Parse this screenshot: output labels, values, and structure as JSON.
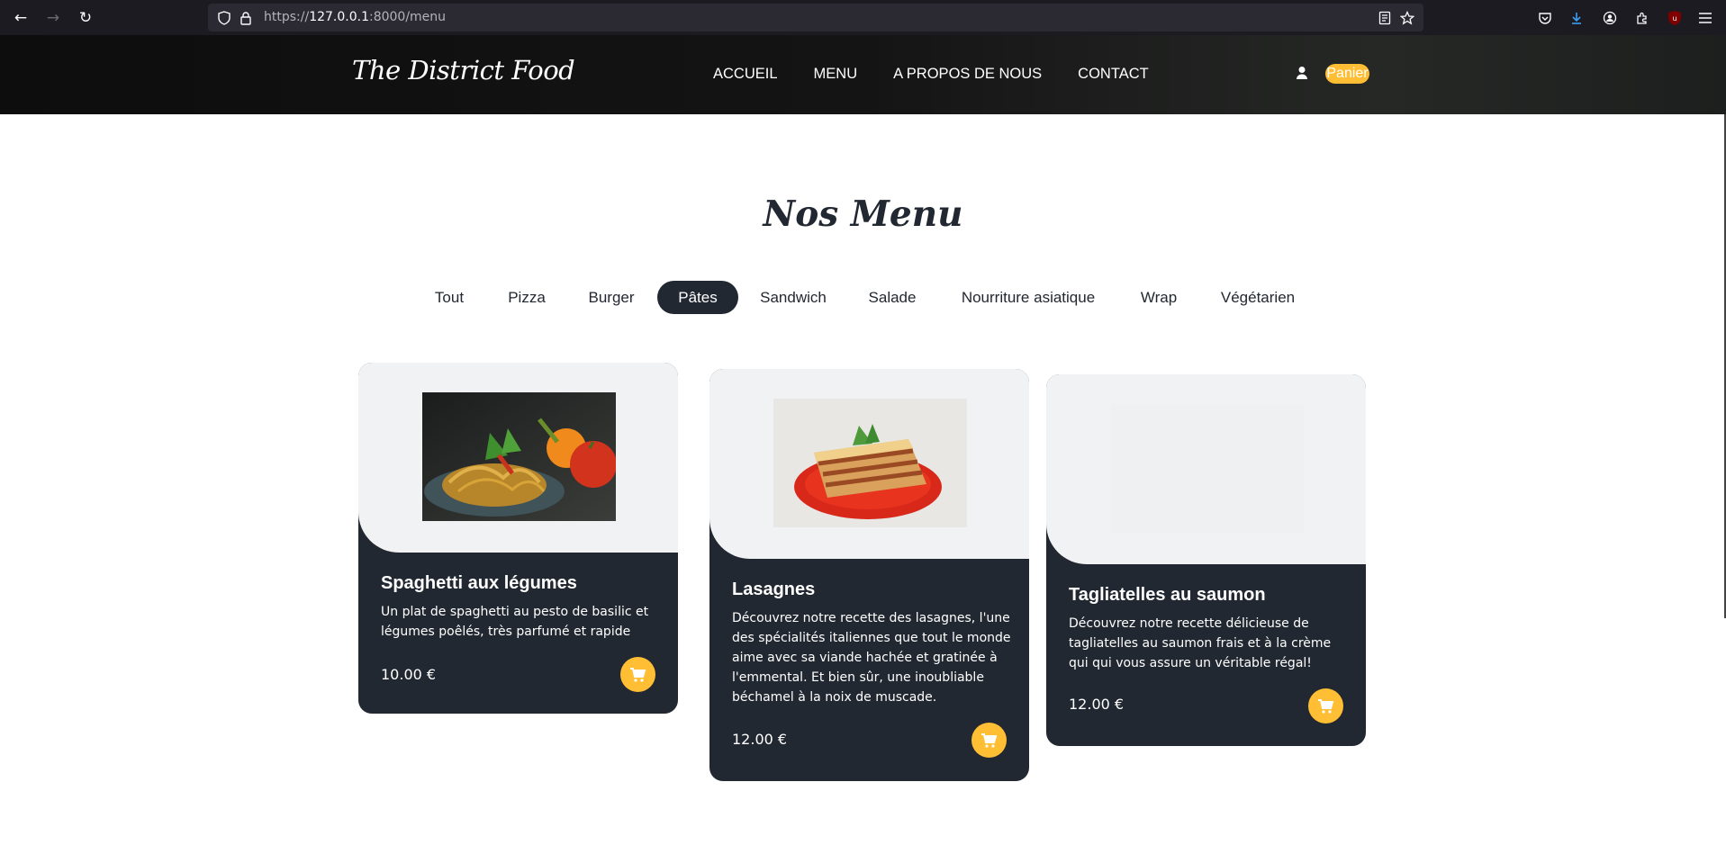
{
  "browser": {
    "url_prefix": "https://",
    "url_host": "127.0.0.1",
    "url_rest": ":8000/menu"
  },
  "header": {
    "logo": "The District Food",
    "nav": [
      "ACCUEIL",
      "MENU",
      "A PROPOS DE NOUS",
      "CONTACT"
    ],
    "cart_label": "Panier"
  },
  "section_title": "Nos Menu",
  "filters": [
    "Tout",
    "Pizza",
    "Burger",
    "Pâtes",
    "Sandwich",
    "Salade",
    "Nourriture asiatique",
    "Wrap",
    "Végétarien"
  ],
  "active_filter": "Pâtes",
  "dishes": [
    {
      "title": "Spaghetti aux légumes",
      "description": "Un plat de spaghetti au pesto de basilic et légumes poêlés, très parfumé et rapide",
      "price": "10.00 €"
    },
    {
      "title": "Lasagnes",
      "description": "Découvrez notre recette des lasagnes, l'une des spécialités italiennes que tout le monde aime avec sa viande hachée et gratinée à l'emmental. Et bien sûr, une inoubliable béchamel à la noix de muscade.",
      "price": "12.00 €"
    },
    {
      "title": "Tagliatelles au saumon",
      "description": "Découvrez notre recette délicieuse de tagliatelles au saumon frais et à la crème qui qui vous assure un véritable régal!",
      "price": "12.00 €"
    }
  ],
  "colors": {
    "accent": "#ffbe33",
    "dark": "#222831",
    "card_image_bg": "#f1f2f3"
  }
}
